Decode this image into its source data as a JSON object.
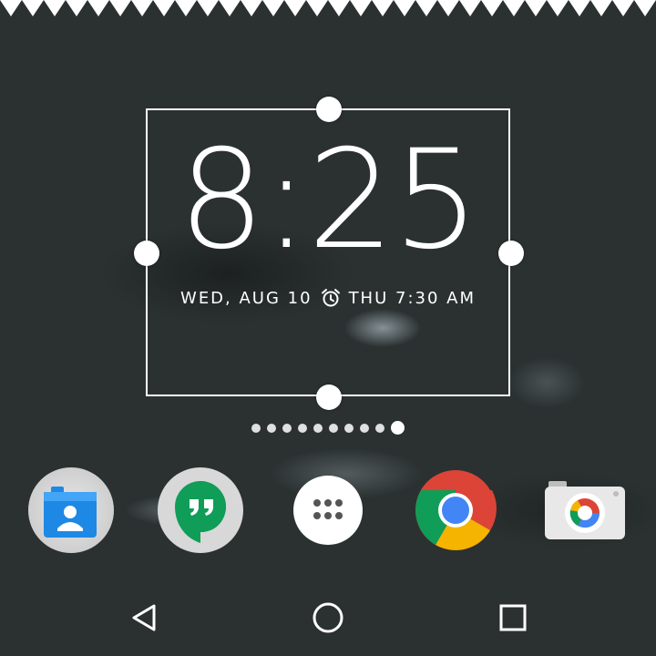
{
  "clock": {
    "time": "8:25",
    "date": "WED, AUG 10",
    "alarm": "THU 7:30 AM",
    "alarm_icon": "alarm-clock-icon"
  },
  "home_pages": {
    "count": 10,
    "current": 10
  },
  "dock": [
    {
      "name": "Contacts",
      "icon": "contacts-icon"
    },
    {
      "name": "Hangouts",
      "icon": "hangouts-icon"
    },
    {
      "name": "All apps",
      "icon": "app-drawer-icon"
    },
    {
      "name": "Chrome",
      "icon": "chrome-icon"
    },
    {
      "name": "Camera",
      "icon": "camera-icon"
    }
  ],
  "navigation": [
    "back-icon",
    "home-icon",
    "recents-icon"
  ],
  "colors": {
    "wallpaper": "#2b3131",
    "handle": "#ffffff",
    "chrome_red": "#db4437",
    "chrome_green": "#0f9d58",
    "chrome_yellow": "#f4b400",
    "chrome_blue": "#4285f4",
    "hangouts_green": "#0f9d58",
    "contacts_blue": "#1e88e5"
  }
}
